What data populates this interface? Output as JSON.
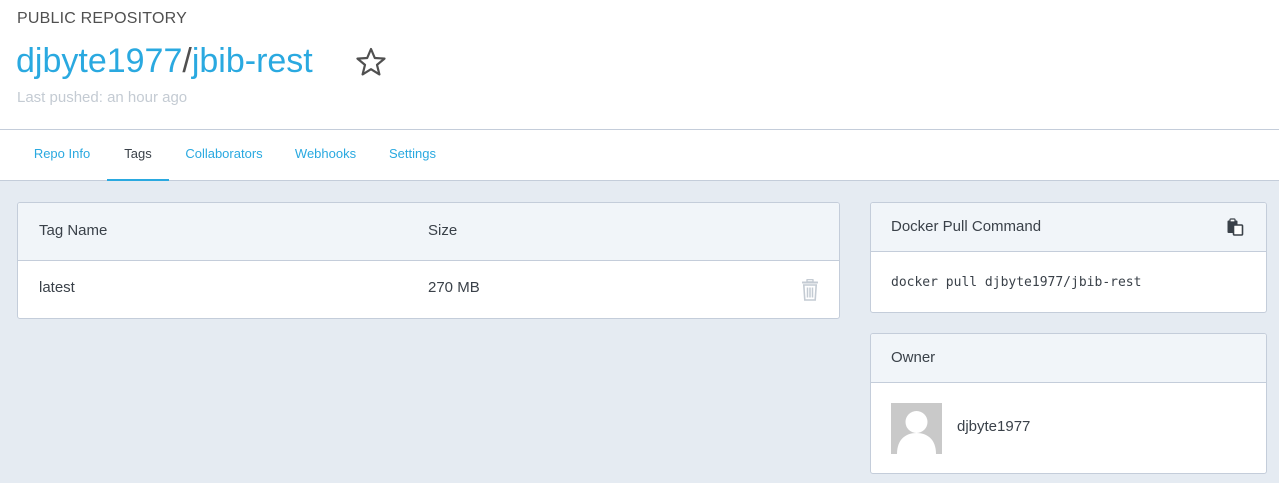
{
  "header": {
    "repo_type": "PUBLIC REPOSITORY",
    "owner": "djbyte1977",
    "separator": "/",
    "repo_name": "jbib-rest",
    "last_pushed": "Last pushed: an hour ago",
    "star_icon": "star-outline-icon"
  },
  "tabs": [
    {
      "label": "Repo Info",
      "active": false
    },
    {
      "label": "Tags",
      "active": true
    },
    {
      "label": "Collaborators",
      "active": false
    },
    {
      "label": "Webhooks",
      "active": false
    },
    {
      "label": "Settings",
      "active": false
    }
  ],
  "tags_table": {
    "columns": [
      "Tag Name",
      "Size"
    ],
    "rows": [
      {
        "tag": "latest",
        "size": "270 MB",
        "delete_icon": "trash-icon"
      }
    ]
  },
  "pull_command": {
    "title": "Docker Pull Command",
    "command": "docker pull djbyte1977/jbib-rest",
    "copy_icon": "clipboard-copy-icon"
  },
  "owner_panel": {
    "title": "Owner",
    "username": "djbyte1977",
    "avatar_icon": "default-avatar-icon"
  },
  "colors": {
    "accent": "#2aa9e0",
    "text": "#3a4149",
    "muted": "#c4cbd3",
    "background": "#e5ebf2",
    "panel_header": "#f1f5f9",
    "border": "#c4cdda"
  }
}
